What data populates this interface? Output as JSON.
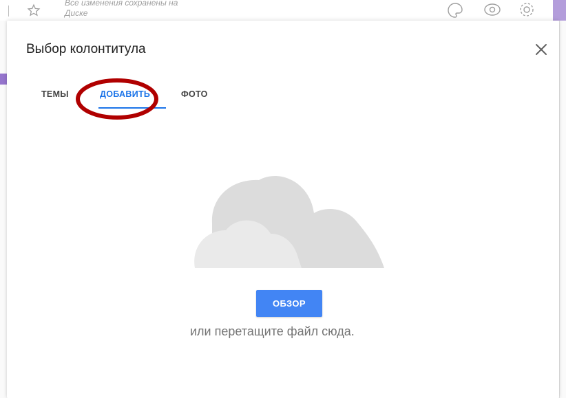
{
  "background": {
    "saved_status": "Все изменения сохранены на Диске",
    "icons": [
      "star-icon",
      "palette-icon",
      "eye-icon",
      "gear-icon"
    ],
    "accent_color": "#b39ddb"
  },
  "dialog": {
    "title": "Выбор колонтитула",
    "close_icon": "close-icon",
    "tabs": [
      {
        "label": "ТЕМЫ",
        "active": false
      },
      {
        "label": "ДОБАВИТЬ",
        "active": true
      },
      {
        "label": "ФОТО",
        "active": false
      }
    ],
    "annotation_color": "#b00000",
    "illustration": "cloud-icon",
    "browse_button": {
      "label": "ОБЗОР",
      "color": "#4285f4"
    },
    "drop_hint": "или перетащите файл сюда."
  }
}
